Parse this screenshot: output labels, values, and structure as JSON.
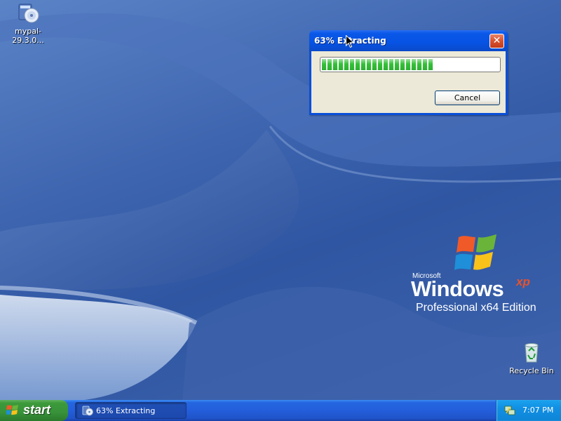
{
  "desktop": {
    "icons": [
      {
        "label": "mypal-29.3.0...",
        "icon": "installer-cd-icon"
      },
      {
        "label": "Recycle Bin",
        "icon": "recycle-bin-icon"
      }
    ],
    "branding": {
      "ms": "Microsoft",
      "windows": "Windows",
      "xp": "xp",
      "edition": "Professional x64 Edition"
    }
  },
  "dialog": {
    "title": "63% Extracting",
    "progress_percent": 63,
    "cancel_label": "Cancel",
    "close_glyph": "✕"
  },
  "taskbar": {
    "start_label": "start",
    "task_item_label": "63% Extracting",
    "clock": "7:07 PM"
  },
  "colors": {
    "titlebar": "#0753e3",
    "progress_green": "#34c038",
    "taskbar_blue": "#245edb",
    "start_green": "#38923a",
    "tray_blue": "#118fe3"
  }
}
